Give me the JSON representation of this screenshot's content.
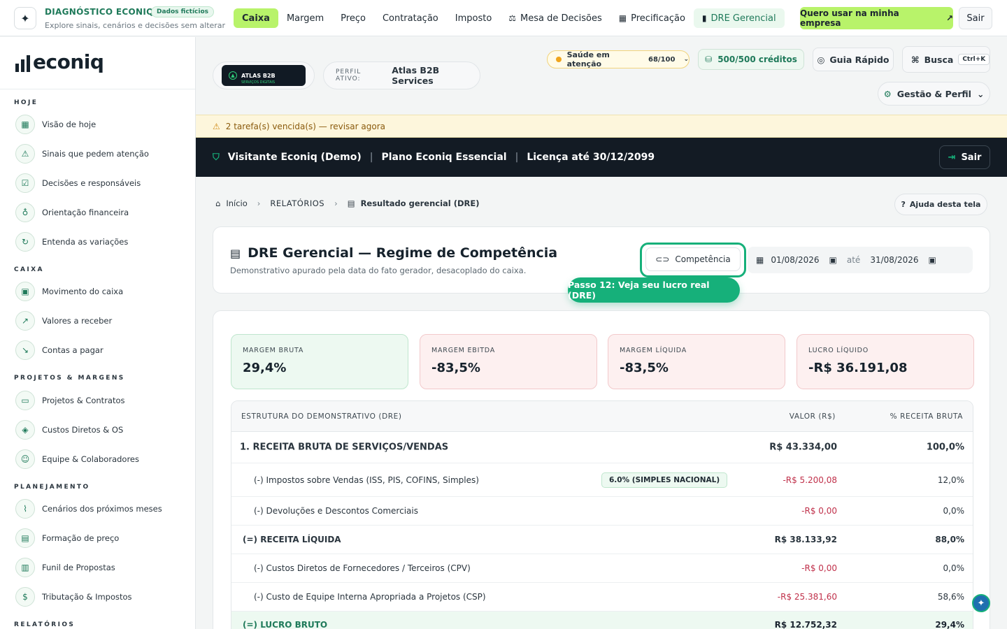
{
  "top": {
    "title": "DIAGNÓSTICO ECONIQ",
    "badge": "Dados fictícios",
    "subtitle": "Explore sinais, cenários e decisões sem alterar da...",
    "nav": [
      {
        "label": "Caixa",
        "icon": "",
        "active": true
      },
      {
        "label": "Margem",
        "icon": ""
      },
      {
        "label": "Preço",
        "icon": ""
      },
      {
        "label": "Contratação",
        "icon": ""
      },
      {
        "label": "Imposto",
        "icon": ""
      },
      {
        "label": "Mesa de Decisões",
        "icon": "gavel-icon"
      },
      {
        "label": "Precificação",
        "icon": "calculator-icon"
      },
      {
        "label": "DRE Gerencial",
        "icon": "document-icon"
      }
    ],
    "cta": "Quero usar na minha empresa",
    "exit": "Sair"
  },
  "sidebar": {
    "brand": "econiq",
    "sections": [
      {
        "title": "HOJE",
        "items": [
          "Visão de hoje",
          "Sinais que pedem atenção",
          "Decisões e responsáveis",
          "Orientação financeira",
          "Entenda as variações"
        ]
      },
      {
        "title": "CAIXA",
        "items": [
          "Movimento do caixa",
          "Valores a receber",
          "Contas a pagar"
        ]
      },
      {
        "title": "PROJETOS & MARGENS",
        "items": [
          "Projetos & Contratos",
          "Custos Diretos & OS",
          "Equipe & Colaboradores"
        ]
      },
      {
        "title": "PLANEJAMENTO",
        "items": [
          "Cenários dos próximos meses",
          "Formação de preço",
          "Funil de Propostas",
          "Tributação & Impostos"
        ]
      },
      {
        "title": "RELATÓRIOS",
        "items": []
      }
    ]
  },
  "header": {
    "company_logo_name": "ATLAS B2B",
    "company_logo_tag": "SERVIÇOS DIGITAIS",
    "active_label": "PERFIL ATIVO:",
    "active_name": "Atlas B2B Services",
    "health_label": "Saúde em atenção",
    "health_score": "68/100",
    "credits": "500/500 créditos",
    "guide": "Guia Rápido",
    "search": "Busca",
    "search_kbd": "Ctrl+K",
    "gestao": "Gestão & Perfil"
  },
  "alert": "2 tarefa(s) vencida(s) — revisar agora",
  "license": {
    "user": "Visitante Econiq (Demo)",
    "plan": "Plano Econiq Essencial",
    "valid": "Licença até 30/12/2099",
    "exit": "Sair"
  },
  "breadcrumb": {
    "home": "Início",
    "section": "RELATÓRIOS",
    "page": "Resultado gerencial (DRE)"
  },
  "help": "Ajuda desta tela",
  "title_card": {
    "title": "DRE Gerencial — Regime de Competência",
    "subtitle": "Demonstrativo apurado pela data do fato gerador, desacoplado do caixa.",
    "toggle": "Competência",
    "date_from": "01/08/2026",
    "date_sep": "até",
    "date_to": "31/08/2026",
    "step": "Passo 12: Veja seu lucro real (DRE)"
  },
  "kpis": [
    {
      "label": "MARGEM BRUTA",
      "value": "29,4%",
      "tone": "green"
    },
    {
      "label": "MARGEM EBITDA",
      "value": "-83,5%",
      "tone": "red"
    },
    {
      "label": "MARGEM LÍQUIDA",
      "value": "-83,5%",
      "tone": "red"
    },
    {
      "label": "LUCRO LÍQUIDO",
      "value": "-R$ 36.191,08",
      "tone": "red"
    }
  ],
  "table": {
    "headers": [
      "ESTRUTURA DO DEMONSTRATIVO (DRE)",
      "VALOR (R$)",
      "% RECEITA BRUTA"
    ],
    "rows": [
      {
        "label": "1. RECEITA BRUTA DE SERVIÇOS/VENDAS",
        "value": "R$ 43.334,00",
        "pct": "100,0%"
      },
      {
        "label": "(-) Impostos sobre Vendas (ISS, PIS, COFINS, Simples)",
        "value": "-R$ 5.200,08",
        "pct": "12,0%",
        "tag": "6.0% (SIMPLES NACIONAL)"
      },
      {
        "label": "(-) Devoluções e Descontos Comerciais",
        "value": "-R$ 0,00",
        "pct": "0,0%"
      },
      {
        "label": "(=) RECEITA LÍQUIDA",
        "value": "R$ 38.133,92",
        "pct": "88,0%"
      },
      {
        "label": "(-) Custos Diretos de Fornecedores / Terceiros (CPV)",
        "value": "-R$ 0,00",
        "pct": "0,0%"
      },
      {
        "label": "(-) Custo de Equipe Interna Apropriada a Projetos (CSP)",
        "value": "-R$ 25.381,60",
        "pct": "58,6%"
      },
      {
        "label": "(=) LUCRO BRUTO",
        "value": "R$ 12.752,32",
        "pct": "29,4%"
      }
    ]
  },
  "colors": {
    "accent": "#b8f36a",
    "brand_green": "#16b07a",
    "negative": "#c0304a",
    "dark": "#131b24"
  }
}
